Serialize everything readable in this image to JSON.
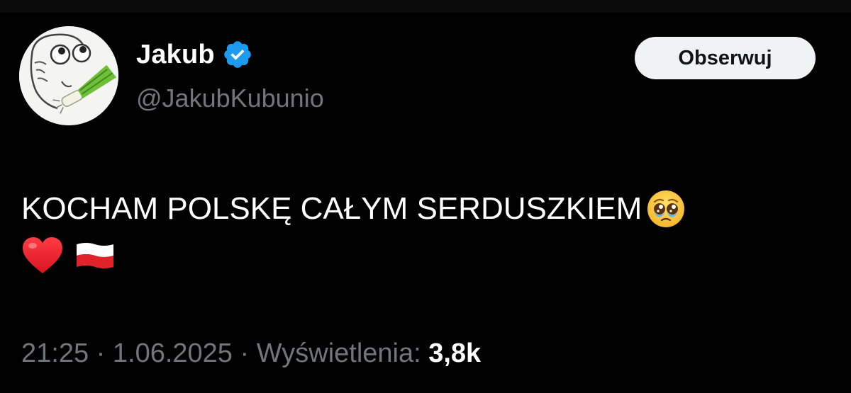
{
  "author": {
    "display_name": "Jakub",
    "handle": "@JakubKubunio",
    "verified": true
  },
  "follow_button_label": "Obserwuj",
  "tweet": {
    "text_line1": "KOCHAM POLSKĘ CAŁYM SERDUSZKIEM",
    "emojis": [
      "pleading-face",
      "red-heart",
      "poland-flag"
    ]
  },
  "meta": {
    "time": "21:25",
    "separator": " · ",
    "date": "1.06.2025",
    "views_label": "Wyświetlenia: ",
    "views_count": "3,8k"
  },
  "colors": {
    "background": "#000000",
    "primary_text": "#ffffff",
    "secondary_text": "#71767b",
    "verified_badge": "#1d9bf0",
    "button_background": "#eff3f4",
    "button_text": "#0f1419"
  }
}
